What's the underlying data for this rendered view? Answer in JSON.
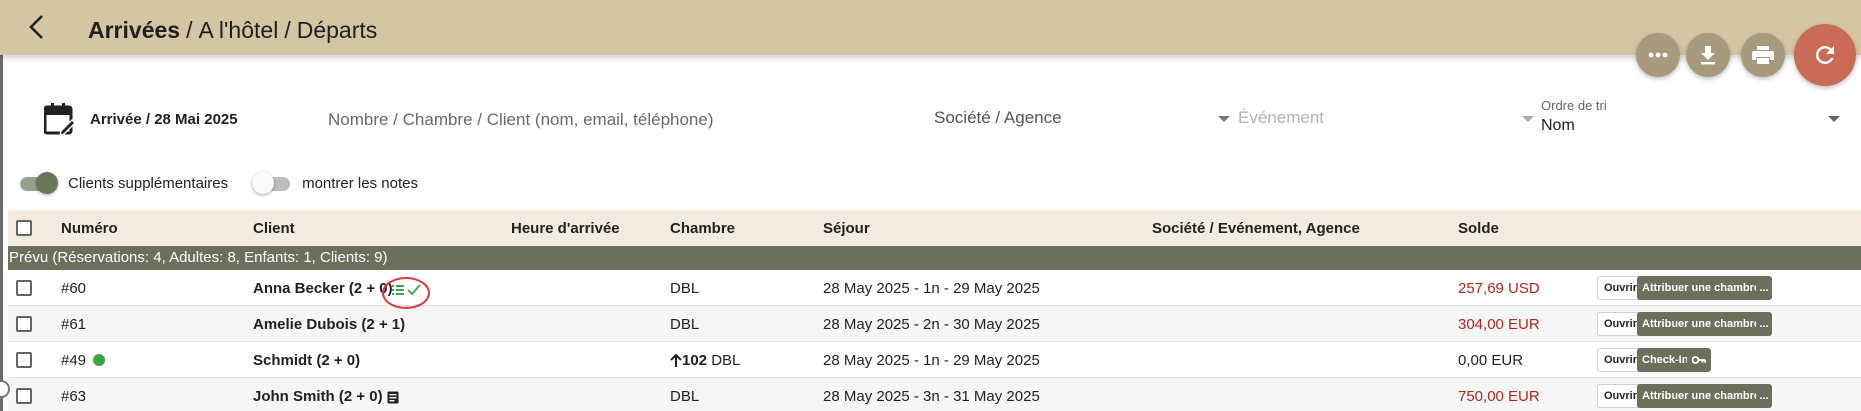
{
  "header": {
    "breadcrumbs": [
      "Arrivées",
      "A l'hôtel",
      "Départs"
    ],
    "separator": "/",
    "actions": [
      "more-icon",
      "download-icon",
      "print-icon",
      "refresh-icon"
    ]
  },
  "filters": {
    "arrival_label": "Arrivée / 28 Mai 2025",
    "search_placeholder": "Nombre / Chambre / Client (nom, email, téléphone)",
    "company_placeholder": "Société / Agence",
    "event_placeholder": "Événement",
    "sort_label": "Ordre de tri",
    "sort_value": "Nom"
  },
  "toggles": [
    {
      "label": "Clients supplémentaires",
      "on": true
    },
    {
      "label": "montrer les notes",
      "on": false
    }
  ],
  "table": {
    "columns": [
      "Numéro",
      "Client",
      "Heure d'arrivée",
      "Chambre",
      "Séjour",
      "Société / Evénement, Agence",
      "Solde"
    ],
    "group_label": "Prévu (Réservations: 4, Adultes: 8, Enfants: 1, Clients: 9)",
    "rows": [
      {
        "number": "#60",
        "client": "Anna Becker (2 + 0)",
        "room": "DBL",
        "stay": "28 May 2025 - 1n - 29 May 2025",
        "balance": "257,69 USD",
        "open": "Ouvrir",
        "action": "Attribuer une chambre",
        "more": "..."
      },
      {
        "number": "#61",
        "client": "Amelie Dubois (2 + 1)",
        "room": "DBL",
        "stay": "28 May 2025 - 2n - 30 May 2025",
        "balance": "304,00 EUR",
        "open": "Ouvrir",
        "action": "Attribuer une chambre",
        "more": "..."
      },
      {
        "number": "#49",
        "client": "Schmidt (2 + 0)",
        "room_number": "102",
        "room": "DBL",
        "stay": "28 May 2025 - 1n - 29 May 2025",
        "balance": "0,00 EUR",
        "open": "Ouvrir",
        "action": "Check-In"
      },
      {
        "number": "#63",
        "client": "John Smith (2 + 0)",
        "room": "DBL",
        "stay": "28 May 2025 - 3n - 31 May 2025",
        "balance": "750,00 EUR",
        "open": "Ouvrir",
        "action": "Attribuer une chambre",
        "more": "..."
      }
    ]
  },
  "colors": {
    "header_bg": "#d4c5a3",
    "accent_dark": "#6b705c",
    "refresh_fab": "#c96b57",
    "balance_due": "#b3261e",
    "status_green": "#3fa34d"
  }
}
